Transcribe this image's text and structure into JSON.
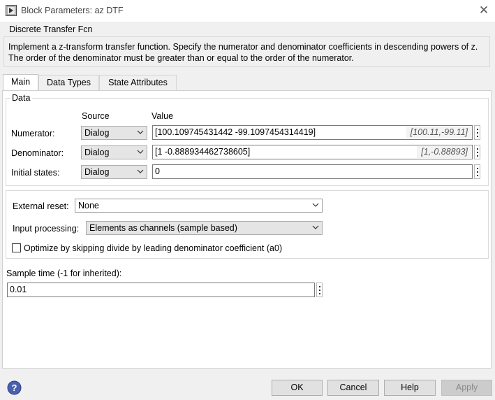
{
  "window": {
    "title": "Block Parameters: az DTF"
  },
  "block": {
    "type_title": "Discrete Transfer Fcn",
    "description": "Implement a z-transform transfer function. Specify the numerator and denominator coefficients in descending powers of z. The order of the denominator must be greater than or equal to the order of the numerator."
  },
  "tabs": [
    {
      "label": "Main",
      "active": true
    },
    {
      "label": "Data Types",
      "active": false
    },
    {
      "label": "State Attributes",
      "active": false
    }
  ],
  "data_group": {
    "label": "Data",
    "source_header": "Source",
    "value_header": "Value",
    "rows": [
      {
        "label": "Numerator:",
        "source": "Dialog",
        "value": "[100.109745431442 -99.1097454314419]",
        "hint": "[100.11,-99.11]"
      },
      {
        "label": "Denominator:",
        "source": "Dialog",
        "value": "[1 -0.888934462738605]",
        "hint": "[1,-0.88893]"
      },
      {
        "label": "Initial states:",
        "source": "Dialog",
        "value": "0",
        "hint": ""
      }
    ]
  },
  "options": {
    "external_reset_label": "External reset:",
    "external_reset_value": "None",
    "input_processing_label": "Input processing:",
    "input_processing_value": "Elements as channels (sample based)",
    "optimize_label": "Optimize by skipping divide by leading denominator coefficient (a0)",
    "optimize_checked": false
  },
  "sample_time": {
    "label": "Sample time (-1 for inherited):",
    "value": "0.01"
  },
  "buttons": {
    "ok": "OK",
    "cancel": "Cancel",
    "help": "Help",
    "apply": "Apply"
  },
  "colors": {
    "accent": "#4a5fb0",
    "panel_bg": "#ffffff",
    "dialog_bg": "#f0f0f0"
  }
}
